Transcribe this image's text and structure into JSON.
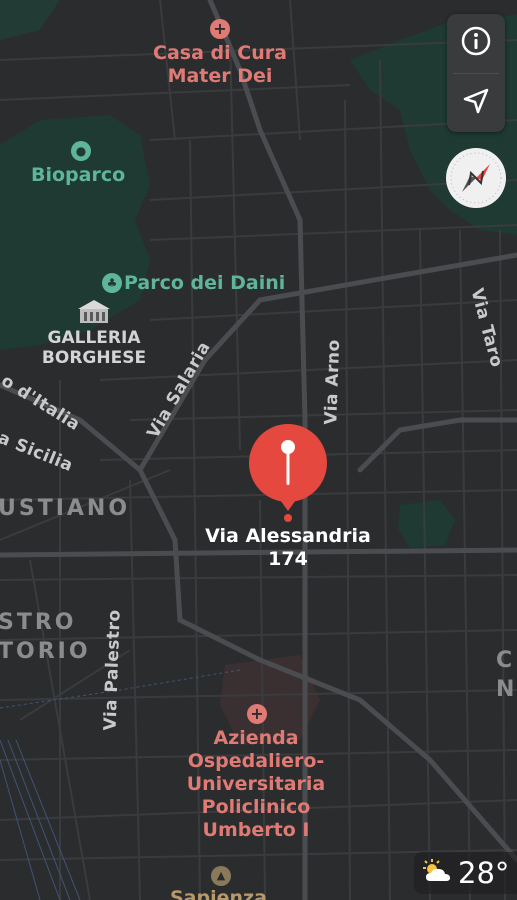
{
  "controls": {
    "info_icon": "info-icon",
    "location_icon": "location-arrow-icon",
    "compass_icon": "compass-icon"
  },
  "pois": {
    "casa_di_cura": "Casa di Cura\nMater Dei",
    "bioparco": "Bioparco",
    "parco_dei_daini": "Parco dei Daini",
    "galleria_borghese": "GALLERIA\nBORGHESE",
    "azienda": "Azienda\nOspedaliero-\nUniversitaria\nPoliclinico\nUmberto I",
    "sapienza": "Sapienza"
  },
  "streets": {
    "via_taro": "Via Taro",
    "via_arno": "Via Arno",
    "via_salaria": "Via Salaria",
    "corso_italia": "o d'Italia",
    "via_sicilia": "a Sicilia",
    "via_palestro": "Via Palestro"
  },
  "districts": {
    "sallustiano": "USTIANO",
    "castro_pretorio": "STRO\nTORIO",
    "right_edge": "C\nN"
  },
  "pin": {
    "label": "Via Alessandria\n174",
    "color": "#e5483f"
  },
  "weather": {
    "icon": "partly-cloudy-sun-icon",
    "temperature": "28°"
  },
  "colors": {
    "background": "#2b2c2e",
    "park": "#1e3a33",
    "road": "#3d3e41",
    "major_road": "#4a4b4e",
    "poi_red": "#e07a74",
    "poi_green": "#5fb59a"
  }
}
